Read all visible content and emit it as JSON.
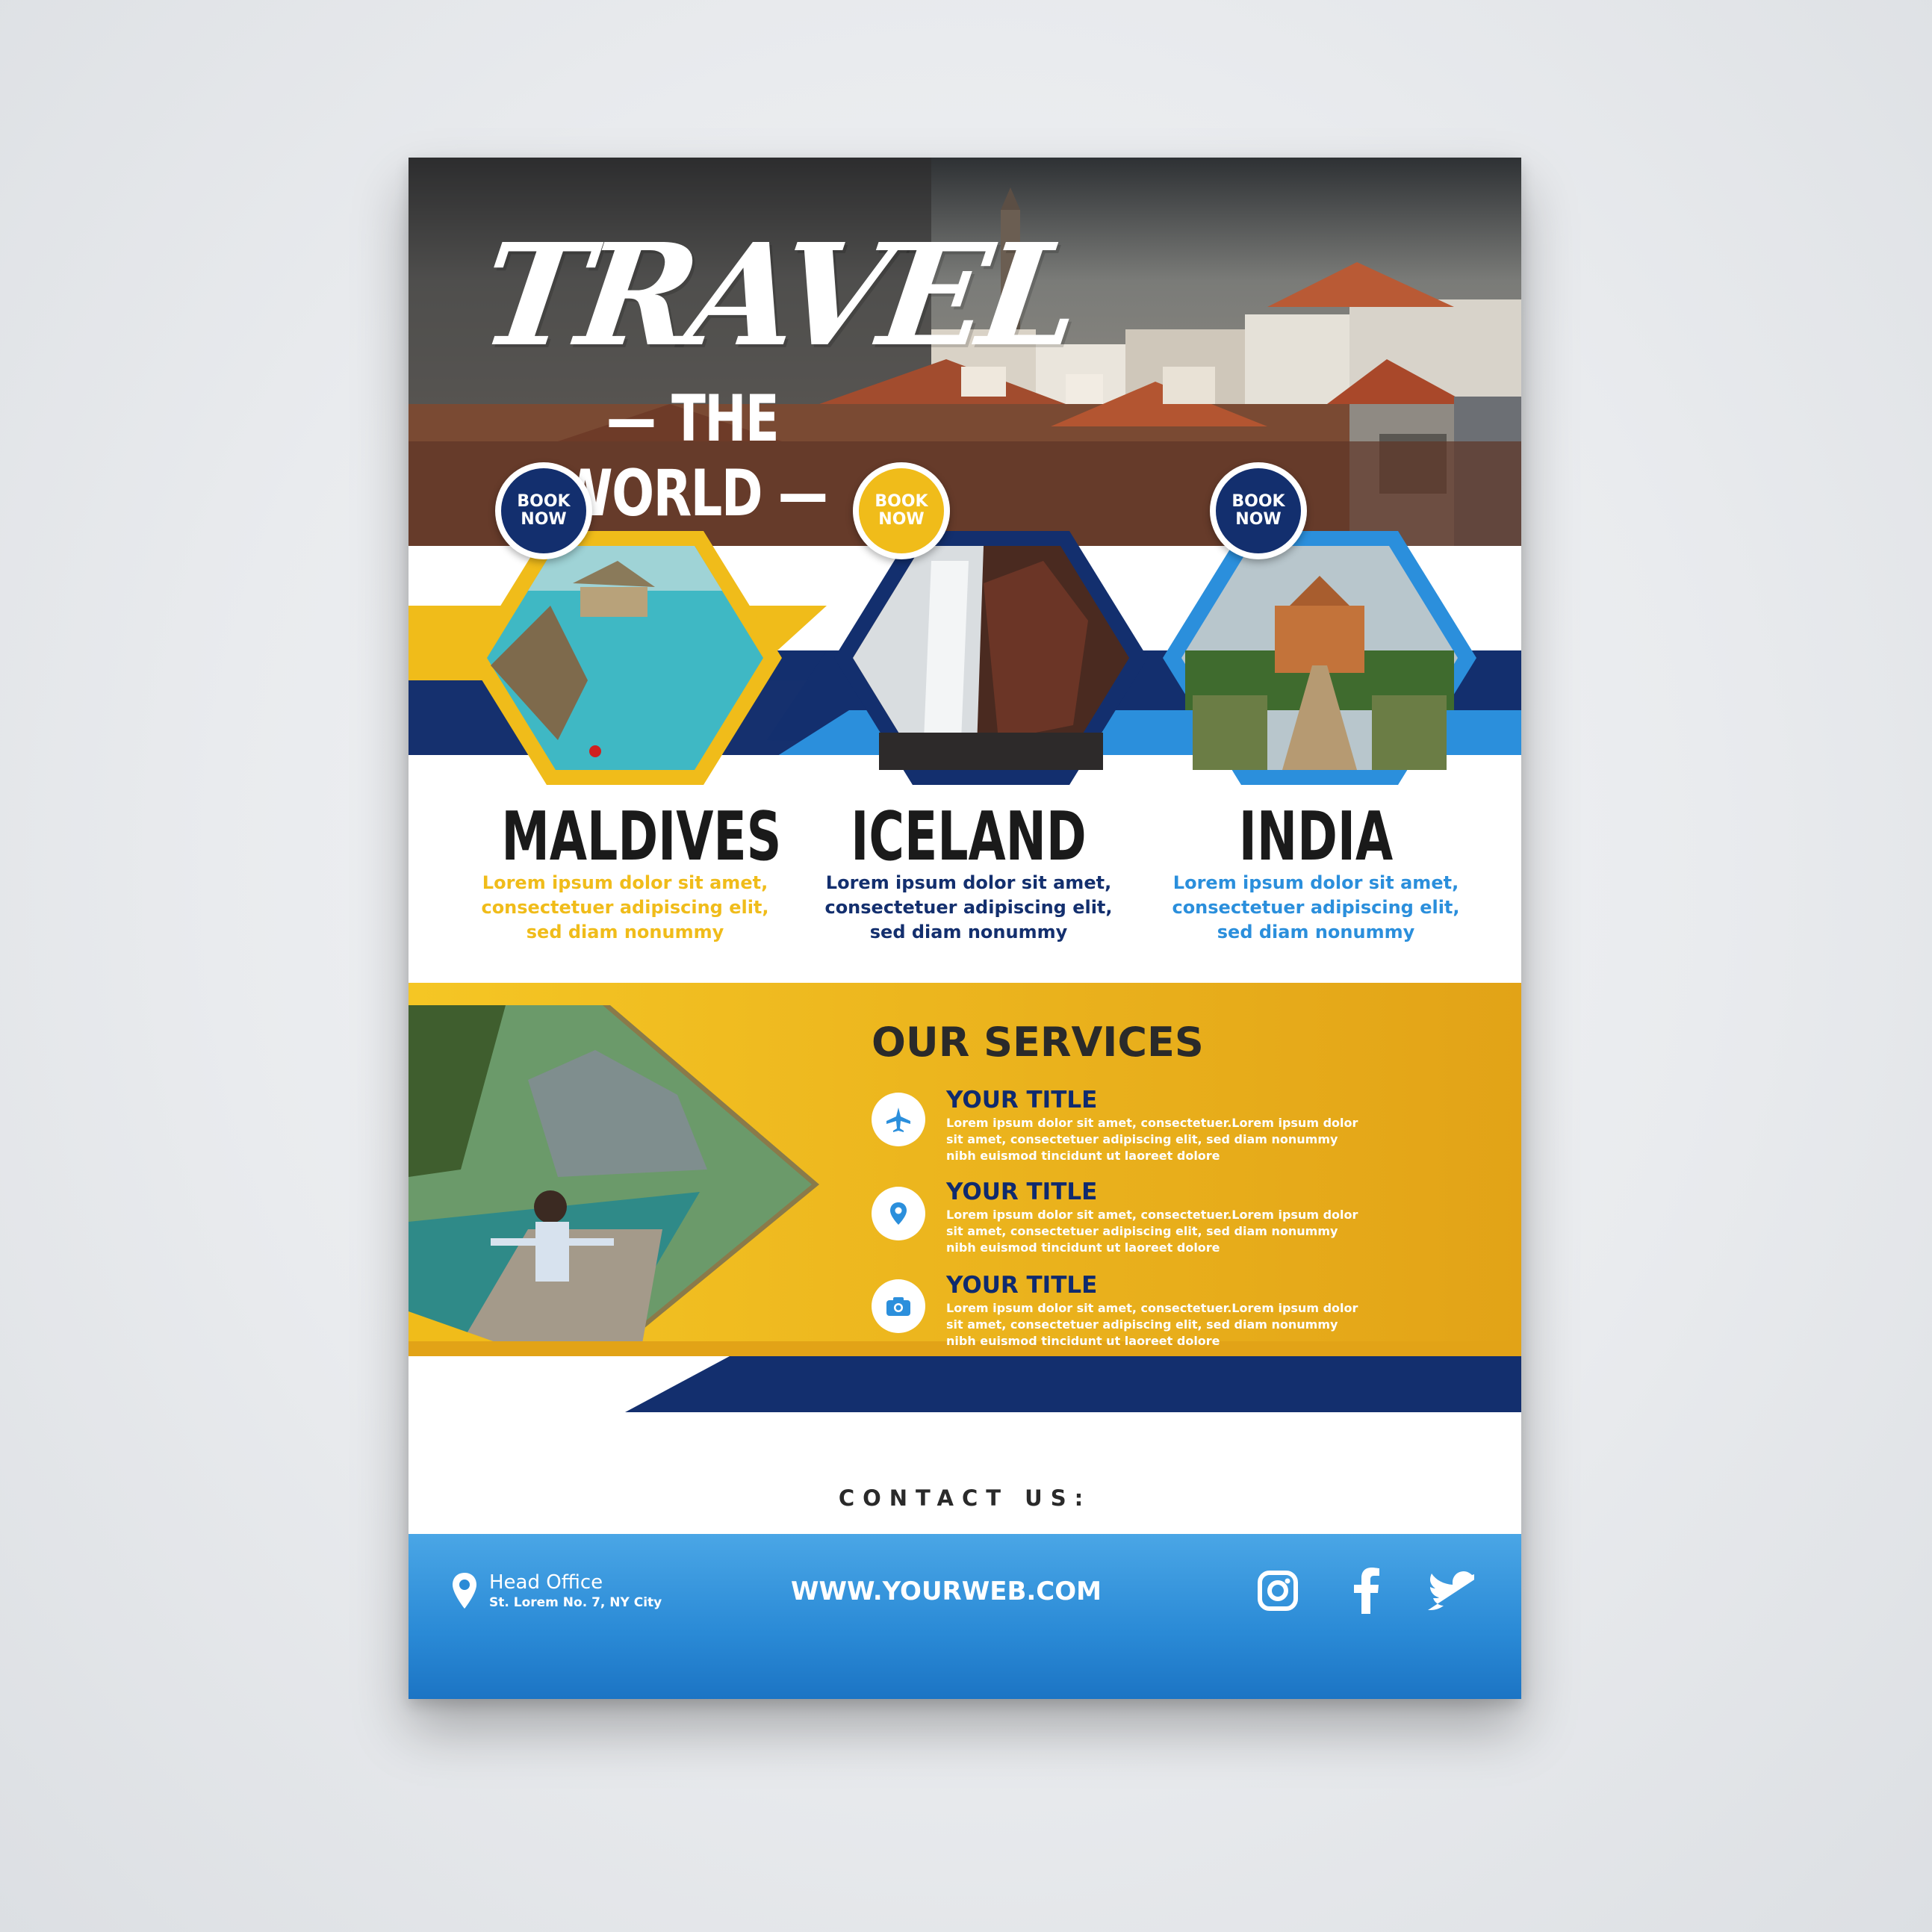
{
  "hero": {
    "title_main": "TRAVEL",
    "title_sub": "— THE WORLD —"
  },
  "colors": {
    "navy": "#132f6e",
    "gold": "#f0bc1a",
    "sky_blue": "#2b8fdc",
    "dark_text": "#1a1a1a"
  },
  "destinations": [
    {
      "book_label": "BOOK NOW",
      "name": "MALDIVES",
      "desc": "Lorem ipsum dolor sit amet, consectetuer adipiscing elit, sed diam nonummy",
      "accent": "#f0bc1a"
    },
    {
      "book_label": "BOOK NOW",
      "name": "ICELAND",
      "desc": "Lorem ipsum dolor sit amet, consectetuer adipiscing elit, sed diam nonummy",
      "accent": "#132f6e"
    },
    {
      "book_label": "BOOK NOW",
      "name": "INDIA",
      "desc": "Lorem ipsum dolor sit amet, consectetuer adipiscing elit, sed diam nonummy",
      "accent": "#2b8fdc"
    }
  ],
  "services": {
    "heading": "OUR SERVICES",
    "items": [
      {
        "icon": "airplane-icon",
        "title": "YOUR TITLE",
        "text": "Lorem ipsum dolor sit amet, consectetuer.Lorem ipsum dolor sit amet, consectetuer adipiscing elit, sed diam nonummy nibh euismod tincidunt ut laoreet dolore"
      },
      {
        "icon": "map-pin-icon",
        "title": "YOUR TITLE",
        "text": "Lorem ipsum dolor sit amet, consectetuer.Lorem ipsum dolor sit amet, consectetuer adipiscing elit, sed diam nonummy nibh euismod tincidunt ut laoreet dolore"
      },
      {
        "icon": "camera-icon",
        "title": "YOUR TITLE",
        "text": "Lorem ipsum dolor sit amet, consectetuer.Lorem ipsum dolor sit amet, consectetuer adipiscing elit, sed diam nonummy nibh euismod tincidunt ut laoreet dolore"
      }
    ]
  },
  "contact": {
    "label": "CONTACT US:",
    "office_label": "Head Office",
    "office_address": "St. Lorem No. 7, NY City",
    "website": "WWW.YOURWEB.COM",
    "social_icons": [
      "instagram-icon",
      "facebook-icon",
      "twitter-icon"
    ]
  }
}
